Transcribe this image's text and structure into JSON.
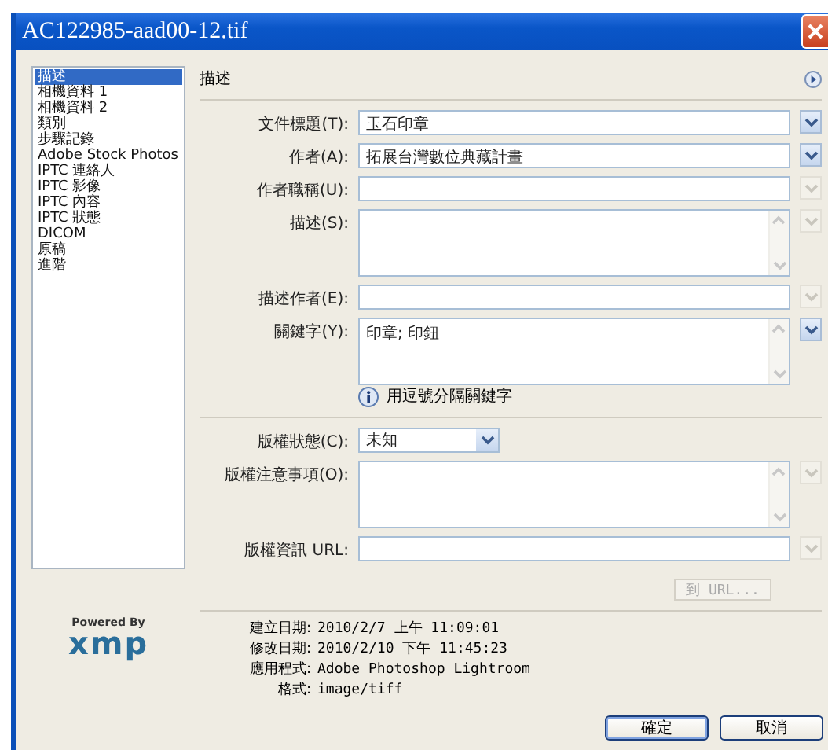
{
  "window": {
    "title": "AC122985-aad00-12.tif"
  },
  "sidebar": {
    "items": [
      {
        "label": "描述",
        "selected": true
      },
      {
        "label": "相機資料 1",
        "selected": false
      },
      {
        "label": "相機資料 2",
        "selected": false
      },
      {
        "label": "類別",
        "selected": false
      },
      {
        "label": "步驟記錄",
        "selected": false
      },
      {
        "label": "Adobe Stock Photos",
        "selected": false
      },
      {
        "label": "IPTC 連絡人",
        "selected": false
      },
      {
        "label": "IPTC 影像",
        "selected": false
      },
      {
        "label": "IPTC 內容",
        "selected": false
      },
      {
        "label": "IPTC 狀態",
        "selected": false
      },
      {
        "label": "DICOM",
        "selected": false
      },
      {
        "label": "原稿",
        "selected": false
      },
      {
        "label": "進階",
        "selected": false
      }
    ]
  },
  "panel": {
    "title": "描述",
    "fields": [
      {
        "label": "文件標題(T):",
        "kind": "text",
        "value": "玉石印章",
        "menu_disabled": false
      },
      {
        "label": "作者(A):",
        "kind": "text",
        "value": "拓展台灣數位典藏計畫",
        "menu_disabled": false
      },
      {
        "label": "作者職稱(U):",
        "kind": "text",
        "menu_disabled": true
      },
      {
        "label": "描述(S):",
        "kind": "textarea",
        "menu_disabled": true
      },
      {
        "label": "描述作者(E):",
        "kind": "text",
        "menu_disabled": true
      },
      {
        "label": "關鍵字(Y):",
        "kind": "textarea",
        "value": "印章; 印鈕",
        "menu_disabled": false
      }
    ],
    "note": "用逗號分隔關鍵字",
    "copyright_fields": [
      {
        "label": "版權狀態(C):",
        "kind": "select",
        "value": "未知"
      },
      {
        "label": "版權注意事項(O):",
        "kind": "textarea",
        "menu_disabled": true
      },
      {
        "label": "版權資訊 URL:",
        "kind": "text",
        "menu_disabled": true
      }
    ],
    "url_button": {
      "label": "到 URL...",
      "disabled": true
    },
    "info": [
      {
        "label": "建立日期:",
        "value": "2010/2/7 上午 11:09:01"
      },
      {
        "label": "修改日期:",
        "value": "2010/2/10 下午 11:45:23"
      },
      {
        "label": "應用程式:",
        "value": "Adobe Photoshop Lightroom"
      },
      {
        "label": "格式:",
        "value": "image/tiff"
      }
    ]
  },
  "logo": {
    "caption": "Powered By",
    "wordmark": "xmp"
  },
  "buttons": [
    {
      "label": "確定",
      "default": true
    },
    {
      "label": "取消",
      "default": false
    }
  ]
}
